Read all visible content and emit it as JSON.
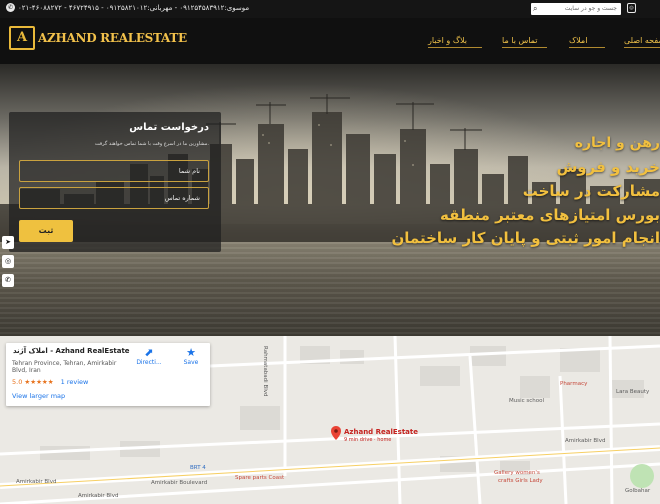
{
  "topbar": {
    "phone": "۰۲۱-۴۶۰۸۸۲۷۲ - ۴۶۷۲۴۹۱۵ - موسوی:۰۹۱۲۵۴۵۸۳۹۱۲ - مهربانی:۰۹۱۲۵۸۲۱۰۱۲",
    "search_placeholder": "جست و جو در سایت",
    "socials": [
      "instagram-icon",
      "telegram-icon",
      "whatsapp-icon"
    ]
  },
  "header": {
    "logo_text": "AZHAND REALESTATE",
    "nav": [
      {
        "label": "صفحه اصلی"
      },
      {
        "label": "املاک"
      },
      {
        "label": "تماس با ما"
      },
      {
        "label": "بلاگ و اخبار"
      }
    ]
  },
  "form": {
    "title": "درخواست تماس",
    "subtitle": "مشاورین ما در اسرع وقت با شما تماس خواهند گرفت.",
    "name_placeholder": "نام شما",
    "phone_placeholder": "شماره تماس",
    "submit_label": "ثبت"
  },
  "hero": {
    "lines": [
      "رهن و اجاره",
      "خرید و فروش",
      "مشارکت در ساخت",
      "بورس امتیازهای معتبر منطقه",
      "انجام امور ثبتی و پایان کار ساختمان"
    ]
  },
  "side_socials": [
    "telegram-icon",
    "instagram-icon",
    "whatsapp-icon"
  ],
  "map": {
    "place_name": "املاک آژند - Azhand RealEstate",
    "address": "Tehran Province, Tehran, Amirkabir Blvd, Iran",
    "rating_value": "5.0",
    "rating_stars": "★★★★★",
    "reviews_text": "1 review",
    "larger_map": "View larger map",
    "directions": "Directi...",
    "save": "Save",
    "pin_label": "Azhand RealEstate",
    "pin_sub": "9 min drive · home",
    "labels": {
      "amirkabir1": "Amirkabir Blvd",
      "amirkabir2": "Amirkabir Blvd",
      "amirkabir3": "Amirkabir Blvd",
      "amirkabir_boulevard": "Amirkabir Boulevard",
      "spare": "Spare parts Coast",
      "gallery": "Gallery women's",
      "gallery2": "crafts Girls Lady",
      "music": "Music school",
      "pharmacy": "Pharmacy",
      "lara": "Lara Beauty",
      "golbahar": "Golbahar",
      "brt": "BRT 4",
      "street": "Rahmatabadi Blvd"
    }
  }
}
